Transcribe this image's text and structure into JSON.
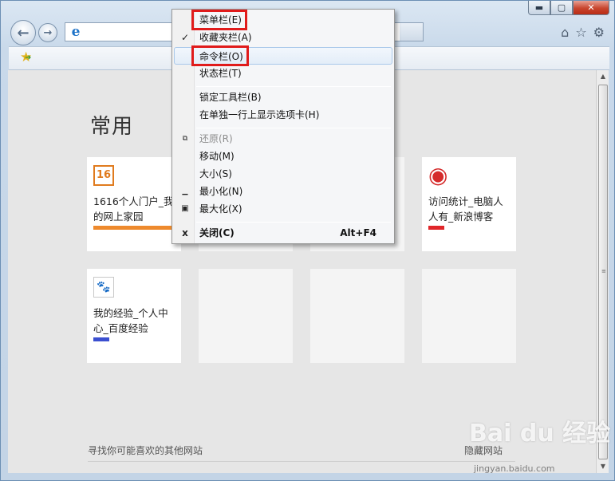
{
  "window": {
    "caption_buttons": [
      {
        "icon": "minimize-icon",
        "glyph": "▬"
      },
      {
        "icon": "maximize-icon",
        "glyph": "▢"
      },
      {
        "icon": "close-icon",
        "glyph": "✕"
      }
    ],
    "nav": {
      "back_glyph": "←",
      "forward_glyph": "→"
    },
    "address": {
      "ie_glyph": "e",
      "value": ""
    },
    "right_icons": [
      {
        "icon": "home-icon",
        "glyph": "⌂"
      },
      {
        "icon": "favorites-star-icon",
        "glyph": "☆"
      },
      {
        "icon": "settings-gear-icon",
        "glyph": "⚙"
      }
    ]
  },
  "favorites_bar": {
    "add_glyph": "★"
  },
  "new_tab_page": {
    "section_title": "常用",
    "tiles": [
      {
        "title": "1616个人门户_我的网上家园",
        "icon": "site-1616-icon",
        "glyph": "16",
        "bar_color": "#ee8a2d"
      },
      {
        "title": "",
        "icon": "",
        "glyph": "",
        "bar_color": ""
      },
      {
        "title": "",
        "icon": "",
        "glyph": "",
        "bar_color": ""
      },
      {
        "title": "访问统计_电脑人人有_新浪博客",
        "icon": "sina-weibo-icon",
        "glyph": "◉",
        "bar_color": "#e0262a"
      },
      {
        "title": "我的经验_个人中心_百度经验",
        "icon": "baidu-paw-icon",
        "glyph": "🐾",
        "bar_color": "#3b4fd0"
      },
      {
        "title": "",
        "icon": "",
        "glyph": "",
        "bar_color": ""
      },
      {
        "title": "",
        "icon": "",
        "glyph": "",
        "bar_color": ""
      },
      {
        "title": "",
        "icon": "",
        "glyph": "",
        "bar_color": ""
      }
    ],
    "footer_left": "寻找你可能喜欢的其他网站",
    "footer_right": "隐藏网站"
  },
  "watermark": {
    "logo": "Bai du 经验",
    "url": "jingyan.baidu.com"
  },
  "context_menu": {
    "items": [
      {
        "label": "菜单栏(E)",
        "mark": "",
        "shortcut": "",
        "state": "normal",
        "highlighted": true
      },
      {
        "label": "收藏夹栏(A)",
        "mark": "✓",
        "shortcut": "",
        "state": "normal",
        "highlighted": false
      },
      {
        "label": "命令栏(O)",
        "mark": "",
        "shortcut": "",
        "state": "hover",
        "highlighted": true
      },
      {
        "label": "状态栏(T)",
        "mark": "",
        "shortcut": "",
        "state": "normal",
        "highlighted": false
      },
      {
        "label": "锁定工具栏(B)",
        "mark": "",
        "shortcut": "",
        "state": "normal",
        "highlighted": false
      },
      {
        "label": "在单独一行上显示选项卡(H)",
        "mark": "",
        "shortcut": "",
        "state": "normal",
        "highlighted": false
      },
      {
        "label": "还原(R)",
        "mark": "⧉",
        "shortcut": "",
        "state": "disabled",
        "highlighted": false
      },
      {
        "label": "移动(M)",
        "mark": "",
        "shortcut": "",
        "state": "normal",
        "highlighted": false
      },
      {
        "label": "大小(S)",
        "mark": "",
        "shortcut": "",
        "state": "normal",
        "highlighted": false
      },
      {
        "label": "最小化(N)",
        "mark": "▁",
        "shortcut": "",
        "state": "normal",
        "highlighted": false
      },
      {
        "label": "最大化(X)",
        "mark": "▣",
        "shortcut": "",
        "state": "normal",
        "highlighted": false
      },
      {
        "label": "关闭(C)",
        "mark": "x",
        "shortcut": "Alt+F4",
        "state": "bold",
        "highlighted": false
      }
    ],
    "highlight_color": "#e01b1b"
  }
}
